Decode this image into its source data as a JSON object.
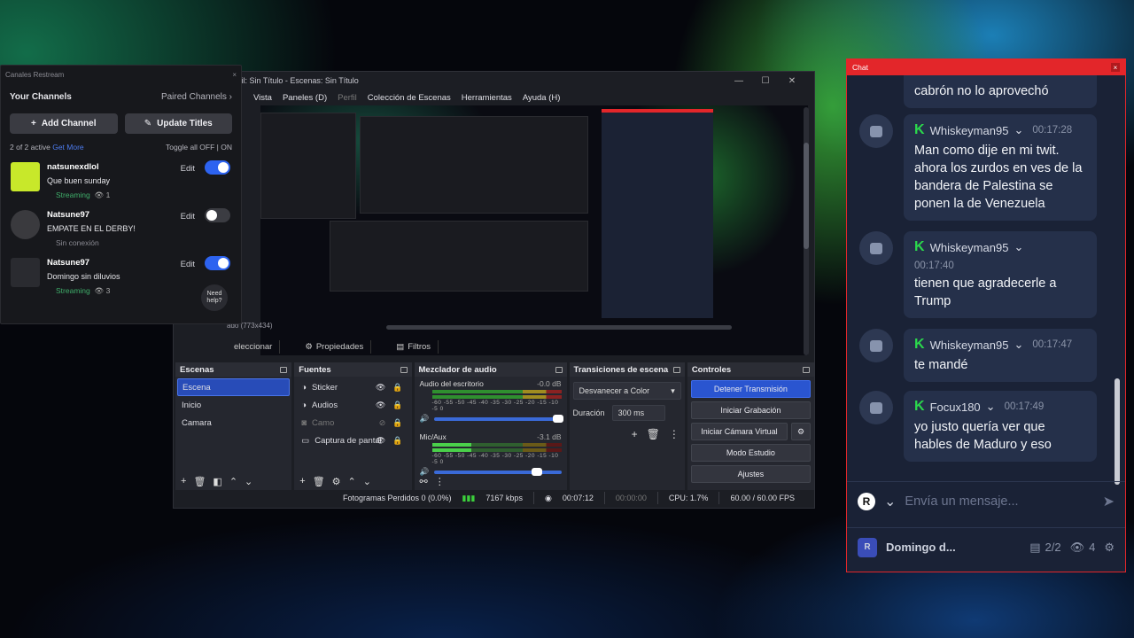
{
  "obs": {
    "window_title": "fil: Sin Título - Escenas: Sin Título",
    "window_controls": [
      "—",
      "☐",
      "✕"
    ],
    "menu": [
      "Vista",
      "Paneles (D)",
      "Perfil",
      "Colección de Escenas",
      "Herramientas",
      "Ayuda (H)"
    ],
    "preview_label": "ado (773x434)",
    "tabs": {
      "select": "eleccionar",
      "props": "Propiedades",
      "filters": "Filtros"
    },
    "scenes": {
      "header": "Escenas",
      "items": [
        "Escena",
        "Inicio",
        "Camara"
      ]
    },
    "sources": {
      "header": "Fuentes",
      "items": [
        {
          "name": "Sticker",
          "visible": true
        },
        {
          "name": "Audios",
          "visible": true
        },
        {
          "name": "Camo",
          "visible": false
        },
        {
          "name": "Captura de pantal",
          "visible": true
        }
      ]
    },
    "mixer": {
      "header": "Mezclador de audio",
      "channels": [
        {
          "name": "Audio del escritorio",
          "db": "-0.0 dB"
        },
        {
          "name": "Mic/Aux",
          "db": "-3.1 dB"
        }
      ],
      "ticks": "-60 -55 -50 -45 -40 -35 -30 -25 -20 -15 -10 -5 0"
    },
    "transitions": {
      "header": "Transiciones de escena",
      "selected": "Desvanecer a Color",
      "duration_label": "Duración",
      "duration_value": "300 ms"
    },
    "controls": {
      "header": "Controles",
      "stop_stream": "Detener Transmisión",
      "start_recording": "Iniciar Grabación",
      "virtual_cam": "Iniciar Cámara Virtual",
      "studio_mode": "Modo Estudio",
      "settings": "Ajustes"
    },
    "status": {
      "dropped": "Fotogramas Perdidos 0 (0.0%)",
      "bitrate": "7167 kbps",
      "stream_time": "00:07:12",
      "rec_time": "00:00:00",
      "cpu": "CPU: 1.7%",
      "fps": "60.00 / 60.00 FPS"
    }
  },
  "restream": {
    "window_title": "Canales Restream",
    "your_channels": "Your Channels",
    "paired_channels": "Paired Channels",
    "add_channel": "Add Channel",
    "update_titles": "Update Titles",
    "active_count": "2 of 2 active",
    "get_more": "Get More",
    "toggle_all": "Toggle all OFF",
    "on_label": "ON",
    "edit_label": "Edit",
    "help": "Need help?",
    "channels": [
      {
        "name": "natsunexdlol",
        "title": "Que buen sunday",
        "status": "Streaming",
        "viewers": "1",
        "enabled": true
      },
      {
        "name": "Natsune97",
        "title": "EMPATE EN EL DERBY!",
        "status": "Sin conexión",
        "viewers": "",
        "enabled": false
      },
      {
        "name": "Natsune97",
        "title": "Domingo sin diluvios",
        "status": "Streaming",
        "viewers": "3",
        "enabled": true
      }
    ]
  },
  "chat": {
    "window_title": "Chat",
    "messages": [
      {
        "user": "",
        "time": "",
        "text": "cabrón no lo aprovechó"
      },
      {
        "user": "Whiskeyman95",
        "time": "00:17:28",
        "text": "Man como dije en mi twit. ahora los zurdos en ves de la bandera de Palestina se ponen la de Venezuela"
      },
      {
        "user": "Whiskeyman95",
        "time": "00:17:40",
        "text": "tienen que agradecerle a Trump"
      },
      {
        "user": "Whiskeyman95",
        "time": "00:17:47",
        "text": "te mandé"
      },
      {
        "user": "Focux180",
        "time": "00:17:49",
        "text": "yo justo quería ver que hables de Maduro y eso"
      }
    ],
    "input_placeholder": "Envía un mensaje...",
    "footer": {
      "stream_name": "Domingo d...",
      "channels": "2/2",
      "viewers": "4"
    }
  }
}
